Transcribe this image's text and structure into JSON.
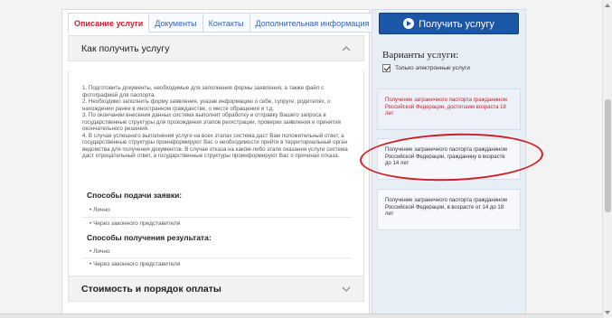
{
  "tabs": [
    {
      "label": "Описание услуги",
      "active": true
    },
    {
      "label": "Документы",
      "active": false
    },
    {
      "label": "Контакты",
      "active": false
    },
    {
      "label": "Дополнительная информация",
      "active": false
    }
  ],
  "how_to": {
    "title": "Как получить услугу",
    "steps": [
      "1. Подготовить документы, необходимые для заполнения формы заявления, а также файл с фотографией для паспорта.",
      "2. Необходимо заполнить форму заявления, указав информацию о себе, супруге, родителях, о нахождении ранее в иностранном гражданстве, о месте обращения и т.д.",
      "3. По окончании внесения данных система выполнит обработку и отправку Вашего запроса в государственные структуры для прохождения этапов регистрации, проверки заявления и принятия окончательного решения.",
      "4. В случае успешного выполнения услуги на всех этапах система даст Вам положительный ответ, а государственные структуры проинформируют Вас о необходимости прийти в территориальный орган ведомства для получения документов. В случае отказа на каком-либо этапе оказания услуги система даст отрицательный ответ, а государственные структуры проинформируют Вас о причинах отказа."
    ],
    "submit_title": "Способы подачи заявки:",
    "submit_ways": [
      "Лично",
      "Через законного представителя"
    ],
    "result_title": "Способы получения результата:",
    "result_ways": [
      "Лично",
      "Через законного представителя"
    ]
  },
  "cost": {
    "title": "Стоимость и порядок оплаты"
  },
  "sidebar": {
    "get_button": "Получить услугу",
    "variants_title": "Варианты услуги:",
    "only_electronic": "Только электронные услуги",
    "services": [
      "Получение заграничного паспорта гражданином Российской Федерации, достигшим возраста 18 лет",
      "Получение заграничного паспорта гражданином Российской Федерации, гражданину в возрасте до 14 лет",
      "Получение заграничного паспорта гражданином Российской Федерации, в возрасте от 14 до 18 лет"
    ]
  },
  "colors": {
    "accent_blue": "#1b57a7",
    "active_tab_red": "#c8202e",
    "annotation_red": "#cc1f25"
  }
}
